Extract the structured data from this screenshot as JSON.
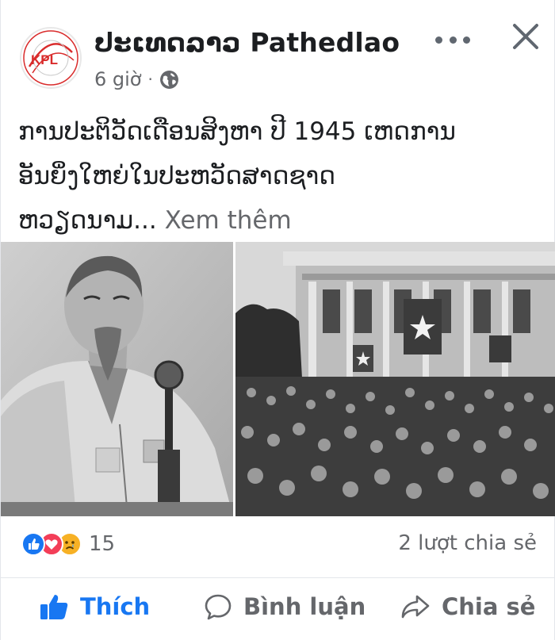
{
  "post": {
    "page_name": "ປະເທດລາວ Pathedlao",
    "time": "6 giờ",
    "time_separator": "·",
    "avatar_text": "KPL",
    "text_lines": [
      "ການປະຕິວັດເດືອນສິງຫາ ປີ 1945 ເຫດການ",
      "ອັນຍິ່ງໃຫຍ່ໃນປະຫວັດສາດຊາດ",
      "ຫວຽດນາມ..."
    ],
    "see_more": "Xem thêm",
    "reaction_count": "15",
    "share_count": "2 lượt chia sẻ",
    "reaction_icons": [
      "like-reaction-icon",
      "love-reaction-icon",
      "sad-reaction-icon"
    ]
  },
  "actions": {
    "like": "Thích",
    "comment": "Bình luận",
    "share": "Chia sẻ"
  },
  "colors": {
    "brand_blue": "#1877f2",
    "love_red": "#f33e58",
    "sad_yellow": "#f7b125",
    "secondary_text": "#65676b",
    "logo_red": "#d92b2b"
  }
}
